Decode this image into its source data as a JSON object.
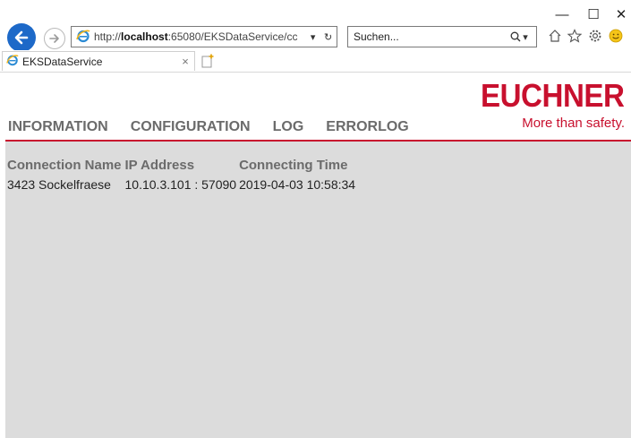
{
  "window": {
    "minimize": "—",
    "maximize": "☐",
    "close": "✕"
  },
  "browser": {
    "address_prefix": "http://",
    "address_host": "localhost",
    "address_rest": ":65080/EKSDataService/cc",
    "search_placeholder": "Suchen...",
    "tab_title": "EKSDataService",
    "tab_close": "×"
  },
  "logo": {
    "brand": "EUCHNER",
    "tagline": "More than safety."
  },
  "menu": {
    "items": [
      "INFORMATION",
      "CONFIGURATION",
      "LOG",
      "ERRORLOG"
    ]
  },
  "table": {
    "headers": [
      "Connection Name",
      "IP Address",
      "Connecting Time"
    ],
    "rows": [
      [
        "3423 Sockelfraese",
        "10.10.3.101 : 57090",
        "2019-04-03 10:58:34"
      ]
    ]
  },
  "colors": {
    "brand_red": "#c8102e",
    "content_bg": "#dcdcdc",
    "menu_gray": "#6b6b6b",
    "back_button_blue": "#1d69c8"
  }
}
